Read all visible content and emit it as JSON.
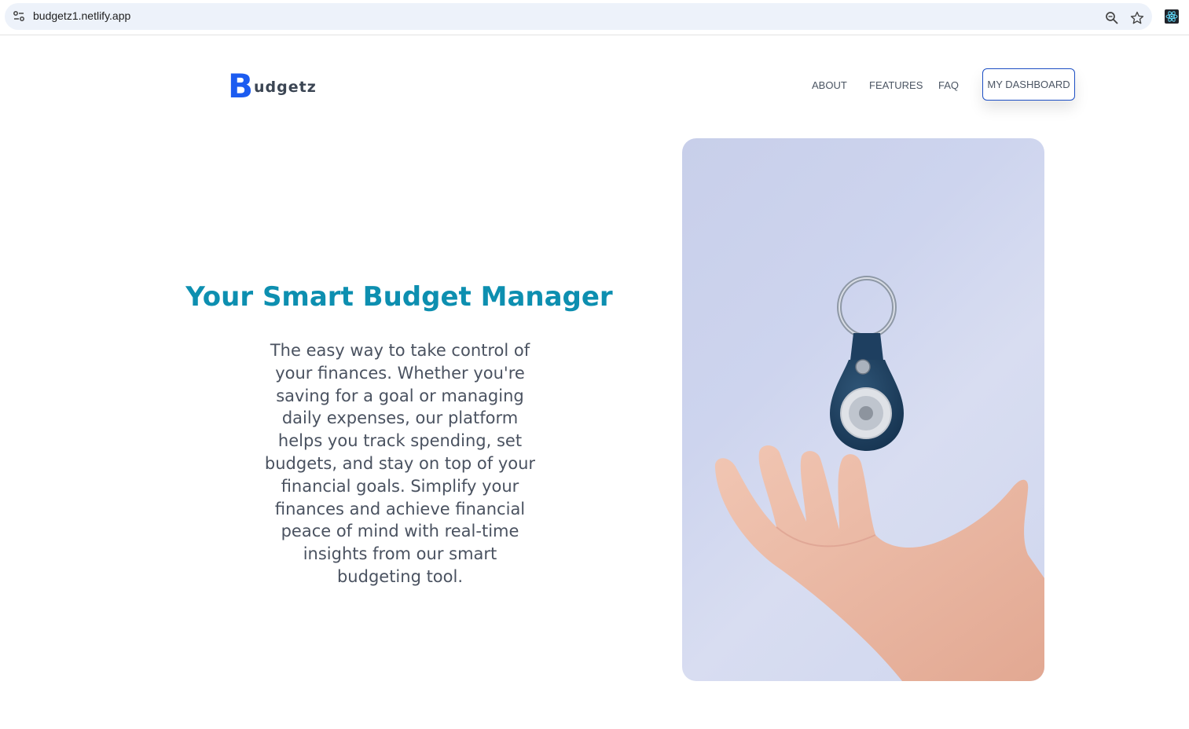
{
  "browser": {
    "url": "budgetz1.netlify.app",
    "icons": [
      "site-info-icon",
      "zoom-icon",
      "star-icon",
      "react-extension-icon"
    ]
  },
  "nav": {
    "logo_initial": "B",
    "logo_rest": "udgetz",
    "links": [
      "ABOUT",
      "FEATURES",
      "FAQ"
    ],
    "cta": "MY DASHBOARD"
  },
  "hero": {
    "title": "Your Smart Budget Manager",
    "description": "The easy way to take control of your finances. Whether you're saving for a goal or managing daily expenses, our platform helps you track spending, set budgets, and stay on top of your financial goals. Simplify your finances and achieve financial peace of mind with real-time insights from our smart budgeting tool."
  },
  "colors": {
    "brand_blue": "#1c5cf0",
    "title_teal": "#0d8fb0",
    "text_gray": "#4a5260",
    "image_bg": "#cdd4ee"
  }
}
